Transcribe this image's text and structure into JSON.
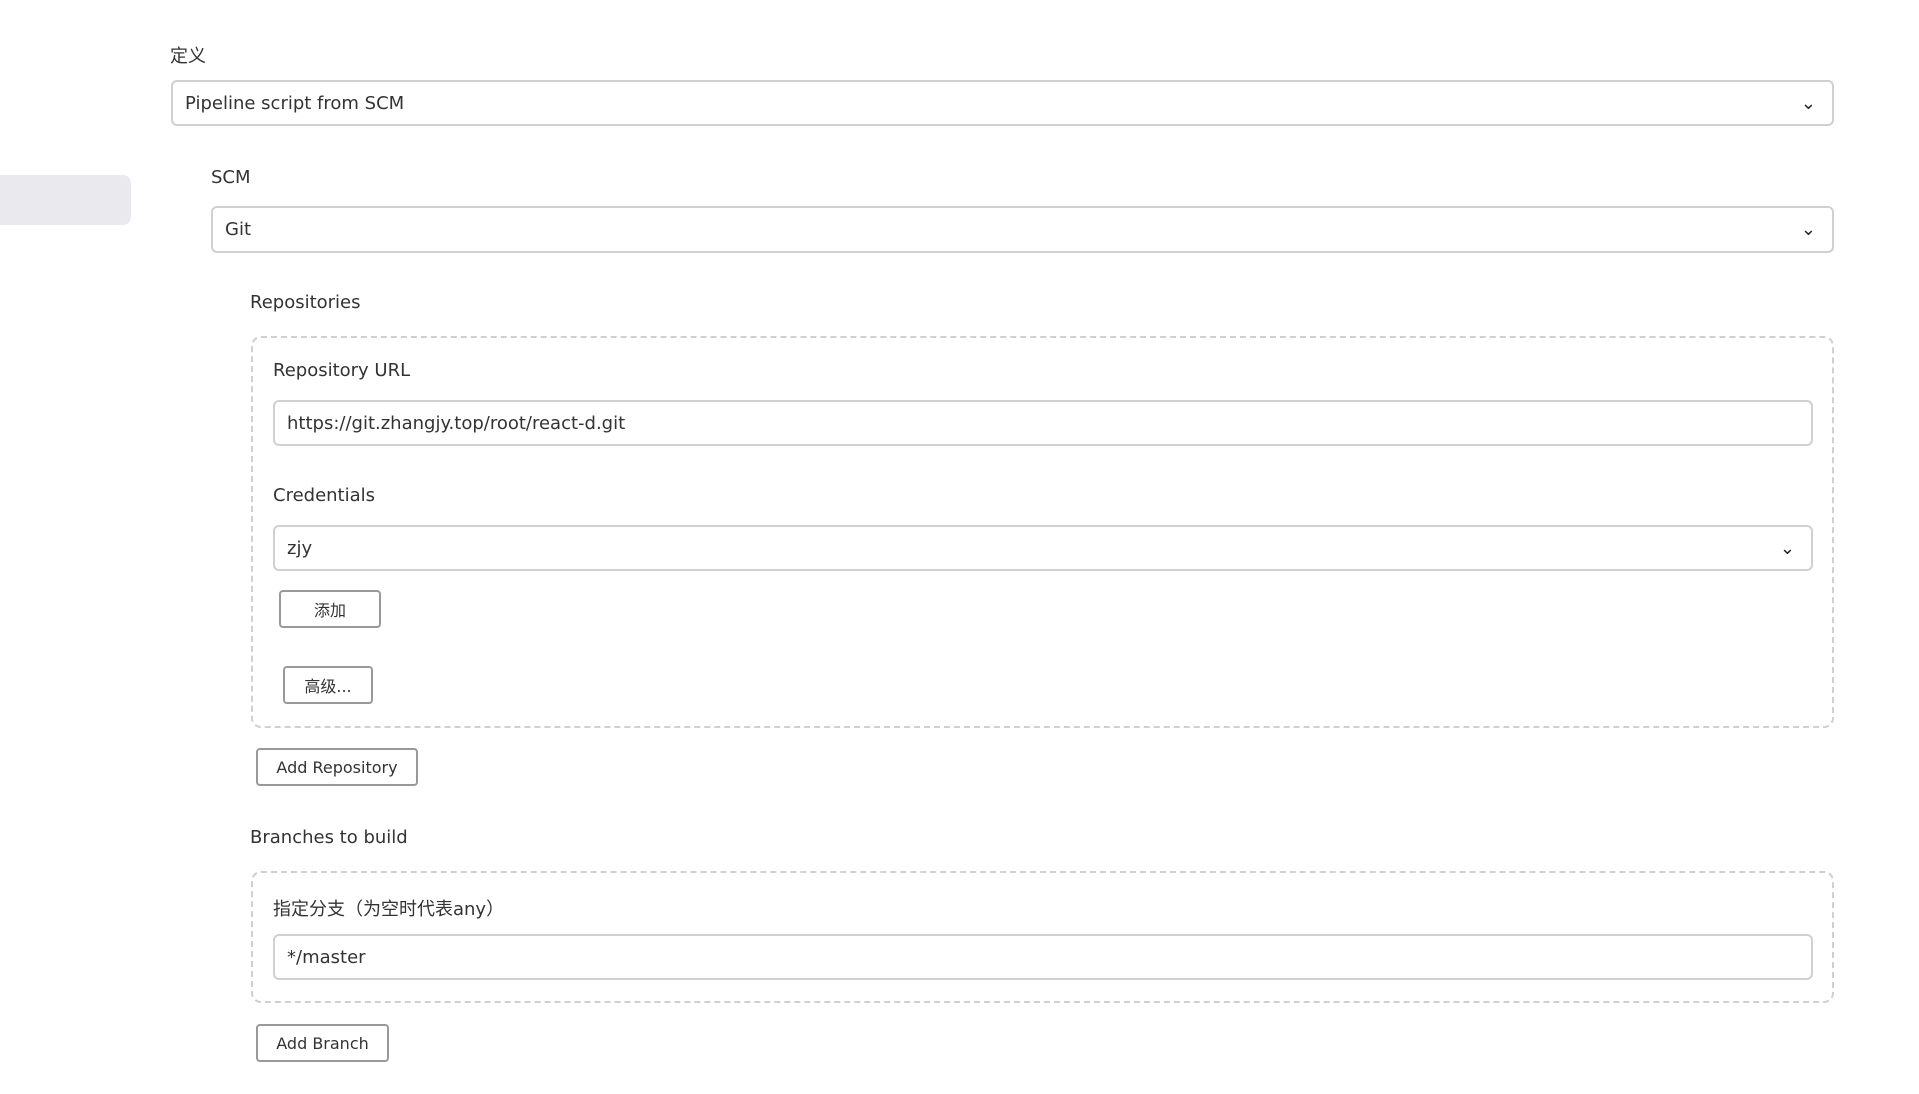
{
  "definition": {
    "label": "定义",
    "value": "Pipeline script from SCM"
  },
  "scm": {
    "label": "SCM",
    "value": "Git"
  },
  "repositories": {
    "label": "Repositories",
    "url_label": "Repository URL",
    "url_value": "https://git.zhangjy.top/root/react-d.git",
    "credentials_label": "Credentials",
    "credentials_value": "zjy",
    "add_label": "添加",
    "advanced_label": "高级...",
    "add_repo_label": "Add Repository"
  },
  "branches": {
    "label": "Branches to build",
    "spec_label": "指定分支（为空时代表any）",
    "spec_value": "*/master",
    "add_branch_label": "Add Branch"
  }
}
